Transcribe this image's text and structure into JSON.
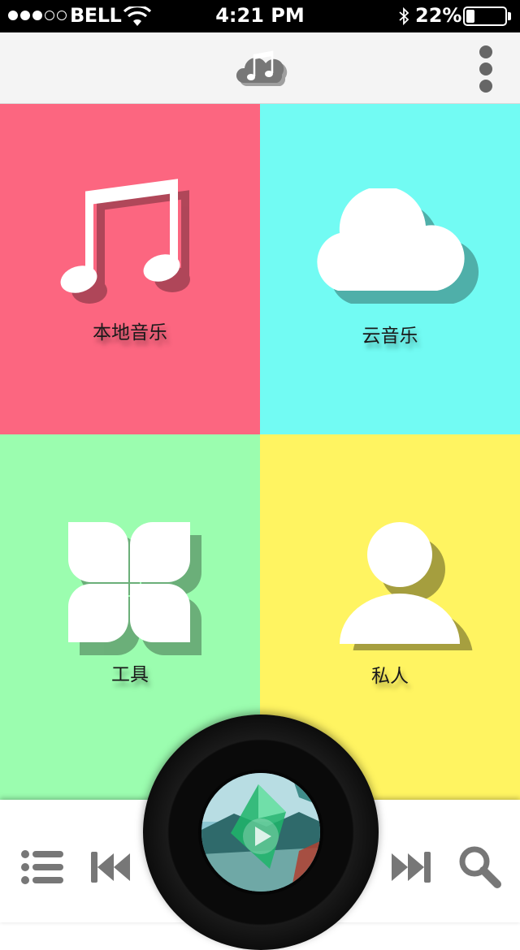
{
  "status_bar": {
    "carrier": "BELL",
    "signal_bars_filled": 3,
    "signal_bars_total": 5,
    "time": "4:21 PM",
    "battery_percent": "22%",
    "battery_level": 0.22
  },
  "header": {
    "logo_icon": "music-cloud-icon",
    "menu_icon": "more-vertical-icon"
  },
  "tiles": [
    {
      "label": "本地音乐",
      "icon": "music-note-icon",
      "color": "#fc6680"
    },
    {
      "label": "云音乐",
      "icon": "cloud-icon",
      "color": "#72fbf3"
    },
    {
      "label": "工具",
      "icon": "tools-petal-icon",
      "color": "#9bfdaf"
    },
    {
      "label": "私人",
      "icon": "person-icon",
      "color": "#fff461"
    }
  ],
  "player": {
    "playlist_icon": "playlist-icon",
    "prev_icon": "skip-previous-icon",
    "play_icon": "play-icon",
    "next_icon": "skip-next-icon",
    "search_icon": "search-icon"
  }
}
